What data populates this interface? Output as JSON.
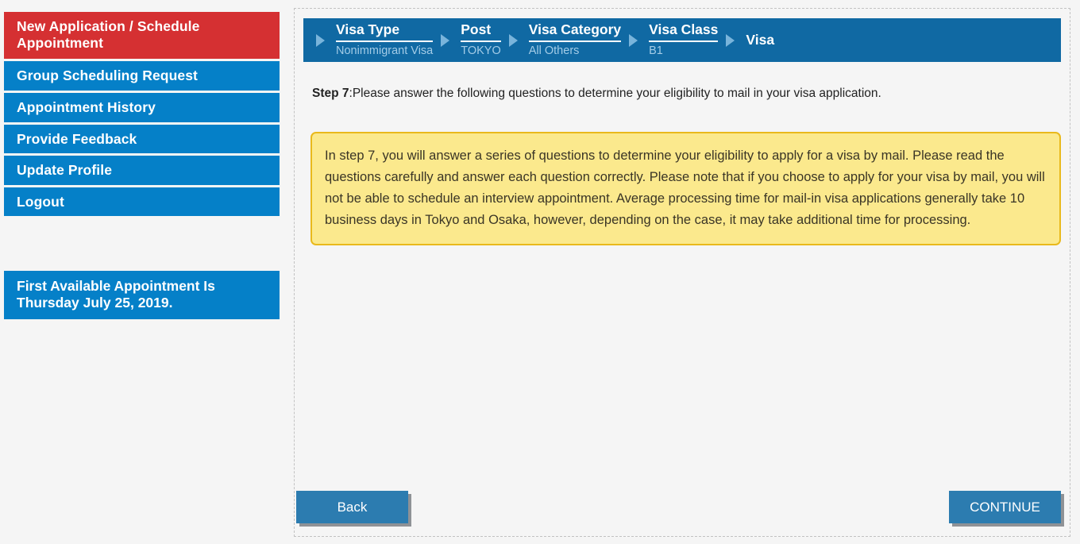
{
  "sidebar": {
    "nav_items": [
      {
        "label": "New Application / Schedule Appointment",
        "active": true
      },
      {
        "label": "Group Scheduling Request",
        "active": false
      },
      {
        "label": "Appointment History",
        "active": false
      },
      {
        "label": "Provide Feedback",
        "active": false
      },
      {
        "label": "Update Profile",
        "active": false
      },
      {
        "label": "Logout",
        "active": false
      }
    ],
    "first_available": "First Available Appointment Is Thursday July 25, 2019."
  },
  "breadcrumb": {
    "arrow_icon": "triangle-right-icon",
    "items": [
      {
        "label": "Visa Type",
        "value": "Nonimmigrant Visa",
        "current": false
      },
      {
        "label": "Post",
        "value": "TOKYO",
        "current": false
      },
      {
        "label": "Visa Category",
        "value": "All Others",
        "current": false
      },
      {
        "label": "Visa Class",
        "value": "B1",
        "current": false
      },
      {
        "label": "Visa",
        "value": "",
        "current": true
      }
    ]
  },
  "main": {
    "step_label": "Step 7",
    "step_text": ":Please answer the following questions to determine your eligibility to mail in your visa application.",
    "note": "In step 7, you will answer a series of questions to determine your eligibility to apply for a visa by mail. Please read the questions carefully and answer each question correctly.  Please note that if you choose to apply for your visa by mail, you will not be able to schedule an interview appointment. Average processing time for mail-in visa applications generally take 10 business days in Tokyo and Osaka, however, depending on the case, it may take additional time for processing."
  },
  "footer": {
    "back_label": "Back",
    "continue_label": "CONTINUE"
  },
  "colors": {
    "nav_blue": "#0580c8",
    "nav_active_red": "#d53032",
    "breadcrumb_blue": "#1069a3",
    "note_bg": "#fbe98d",
    "note_border": "#e9b91c",
    "button_blue": "#2c7cb0",
    "page_bg": "#f5f5f5"
  }
}
